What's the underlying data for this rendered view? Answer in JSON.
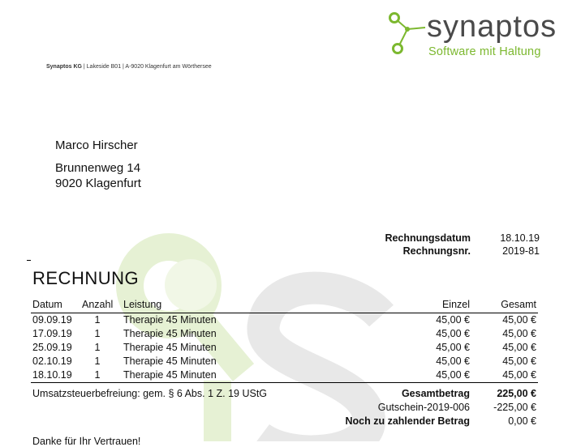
{
  "brand": {
    "name": "synaptos",
    "tagline": "Software mit Haltung",
    "logo_color": "#7cb82f",
    "text_color": "#4a4a4a"
  },
  "sender_line": {
    "company": "Synaptos KG",
    "address": " | Lakeside B01 | A-9020 Klagenfurt am Wörthersee"
  },
  "recipient": {
    "name": "Marco Hirscher",
    "street": "Brunnenweg 14",
    "city": "9020 Klagenfurt"
  },
  "meta": {
    "date_label": "Rechnungsdatum",
    "date_value": "18.10.19",
    "number_label": "Rechnungsnr.",
    "number_value": "2019-81"
  },
  "title": "RECHNUNG",
  "table": {
    "headers": {
      "date": "Datum",
      "qty": "Anzahl",
      "desc": "Leistung",
      "unit": "Einzel",
      "total": "Gesamt"
    },
    "rows": [
      {
        "date": "09.09.19",
        "qty": "1",
        "desc": "Therapie 45 Minuten",
        "unit": "45,00 €",
        "total": "45,00 €"
      },
      {
        "date": "17.09.19",
        "qty": "1",
        "desc": "Therapie 45 Minuten",
        "unit": "45,00 €",
        "total": "45,00 €"
      },
      {
        "date": "25.09.19",
        "qty": "1",
        "desc": "Therapie 45 Minuten",
        "unit": "45,00 €",
        "total": "45,00 €"
      },
      {
        "date": "02.10.19",
        "qty": "1",
        "desc": "Therapie 45 Minuten",
        "unit": "45,00 €",
        "total": "45,00 €"
      },
      {
        "date": "18.10.19",
        "qty": "1",
        "desc": "Therapie 45 Minuten",
        "unit": "45,00 €",
        "total": "45,00 €"
      }
    ]
  },
  "summary": {
    "tax_note": "Umsatzsteuerbefreiung: gem. § 6 Abs. 1 Z. 19 UStG",
    "total_label": "Gesamtbetrag",
    "total_value": "225,00 €",
    "voucher_label": "Gutschein-2019-006",
    "voucher_value": "-225,00 €",
    "due_label": "Noch zu zahlender Betrag",
    "due_value": "0,00 €"
  },
  "closing": "Danke für Ihr Vertrauen!"
}
